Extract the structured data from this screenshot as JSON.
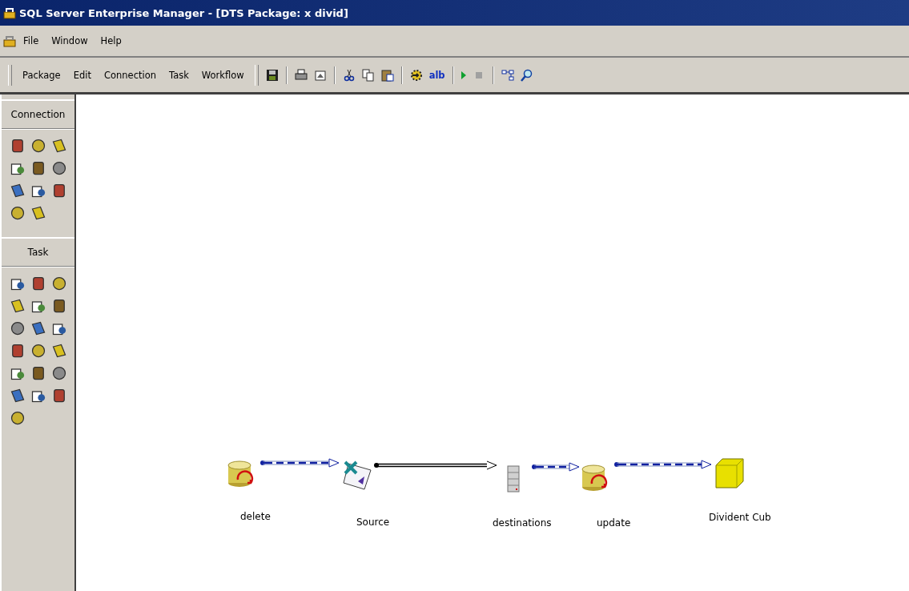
{
  "window": {
    "title": "SQL Server Enterprise Manager - [DTS Package: x divid]"
  },
  "menu": [
    "File",
    "Window",
    "Help"
  ],
  "package_menu": [
    "Package",
    "Edit",
    "Connection",
    "Task",
    "Workflow"
  ],
  "toolbar": [
    {
      "kind": "save"
    },
    {
      "kind": "sep"
    },
    {
      "kind": "print"
    },
    {
      "kind": "properties"
    },
    {
      "kind": "sep"
    },
    {
      "kind": "cut"
    },
    {
      "kind": "copy"
    },
    {
      "kind": "paste"
    },
    {
      "kind": "sep"
    },
    {
      "kind": "gear"
    },
    {
      "kind": "text",
      "label": "alb"
    },
    {
      "kind": "sep"
    },
    {
      "kind": "run"
    },
    {
      "kind": "stop",
      "disabled": true
    },
    {
      "kind": "sep"
    },
    {
      "kind": "layout"
    },
    {
      "kind": "zoom"
    }
  ],
  "palette": [
    {
      "title": "Connection"
    },
    {
      "title": "Task"
    }
  ],
  "nodes": [
    {
      "label": "delete",
      "kind": "sql-task"
    },
    {
      "label": "Source",
      "kind": "excel"
    },
    {
      "label": "destinations",
      "kind": "server"
    },
    {
      "label": "update",
      "kind": "sql-task"
    },
    {
      "label": "Divident Cub",
      "kind": "cube"
    }
  ],
  "links": [
    {
      "kind": "on-success"
    },
    {
      "kind": "transform"
    },
    {
      "kind": "on-success"
    },
    {
      "kind": "on-success"
    }
  ]
}
